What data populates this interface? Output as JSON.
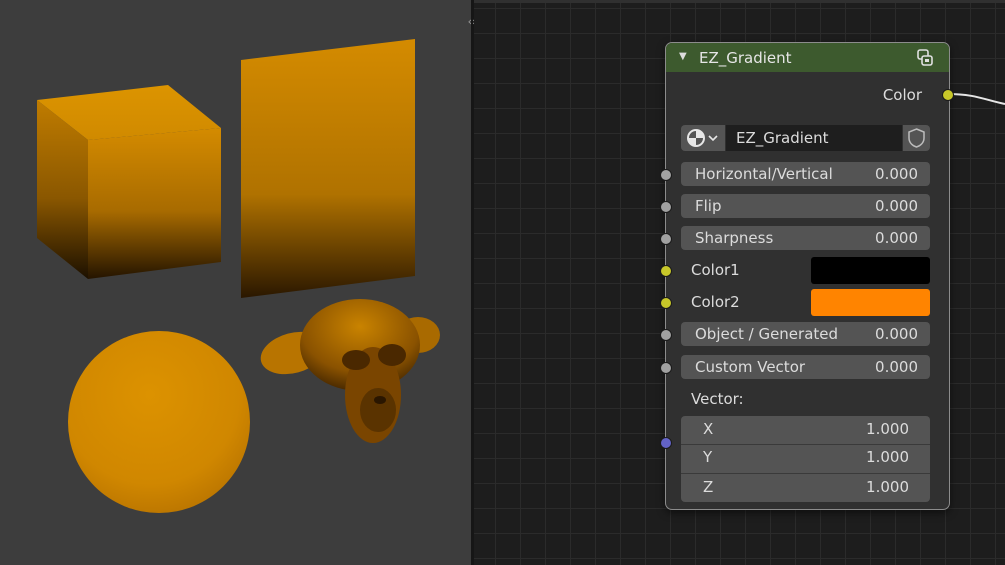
{
  "viewport": {
    "objects": [
      "cube",
      "plane",
      "sphere",
      "monkey"
    ],
    "material_colors": {
      "top": "#d48b00",
      "bottom": "#241400"
    }
  },
  "splitter": {
    "handle_icon": "split-arrows-icon",
    "handle_glyph": "‹›"
  },
  "node": {
    "title": "EZ_Gradient",
    "header_color": "#3d5a2e",
    "collapse_icon": "triangle-down-icon",
    "group_icon": "node-group-icon",
    "output": {
      "label": "Color",
      "socket_color": "#c7c729"
    },
    "group_selector": {
      "icon": "node-tree-icon",
      "name": "EZ_Gradient",
      "fake_user_icon": "shield-icon"
    },
    "inputs": [
      {
        "label": "Horizontal/Vertical",
        "value": "0.000",
        "socket_color": "#a1a1a1"
      },
      {
        "label": "Flip",
        "value": "0.000",
        "socket_color": "#a1a1a1"
      },
      {
        "label": "Sharpness",
        "value": "0.000",
        "socket_color": "#a1a1a1"
      }
    ],
    "color1": {
      "label": "Color1",
      "color": "#000000",
      "socket_color": "#c7c729"
    },
    "color2": {
      "label": "Color2",
      "color": "#ff8400",
      "socket_color": "#c7c729"
    },
    "inputs2": [
      {
        "label": "Object / Generated",
        "value": "0.000",
        "socket_color": "#a1a1a1"
      },
      {
        "label": "Custom Vector",
        "value": "0.000",
        "socket_color": "#a1a1a1"
      }
    ],
    "vector": {
      "label": "Vector:",
      "socket_color": "#6363c7",
      "rows": [
        {
          "axis": "X",
          "value": "1.000"
        },
        {
          "axis": "Y",
          "value": "1.000"
        },
        {
          "axis": "Z",
          "value": "1.000"
        }
      ]
    }
  }
}
